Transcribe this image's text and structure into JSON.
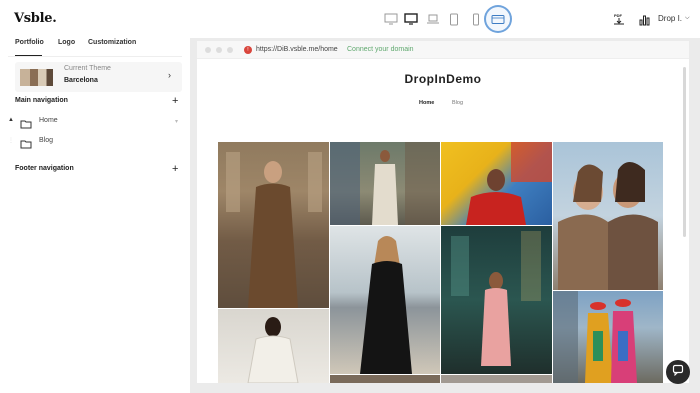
{
  "app": {
    "logo": "Vsble."
  },
  "topbar": {
    "devices": [
      "monitor-icon",
      "desktop-icon",
      "laptop-icon",
      "tablet-icon",
      "mobile-icon",
      "wide-screen-icon"
    ],
    "user_name": "Drop I.",
    "accent": "#6fa3dc"
  },
  "sidebar": {
    "tabs": [
      {
        "label": "Portfolio"
      },
      {
        "label": "Logo"
      },
      {
        "label": "Customization"
      }
    ],
    "theme": {
      "label": "Current Theme",
      "name": "Barcelona"
    },
    "main_nav": {
      "title": "Main navigation",
      "items": [
        {
          "label": "Home"
        },
        {
          "label": "Blog"
        }
      ]
    },
    "footer_nav": {
      "title": "Footer navigation"
    }
  },
  "preview": {
    "url": "https://DiB.vsble.me/home",
    "connect_label": "Connect your domain",
    "site_title": "DropInDemo",
    "site_nav": [
      {
        "label": "Home"
      },
      {
        "label": "Blog"
      }
    ]
  }
}
